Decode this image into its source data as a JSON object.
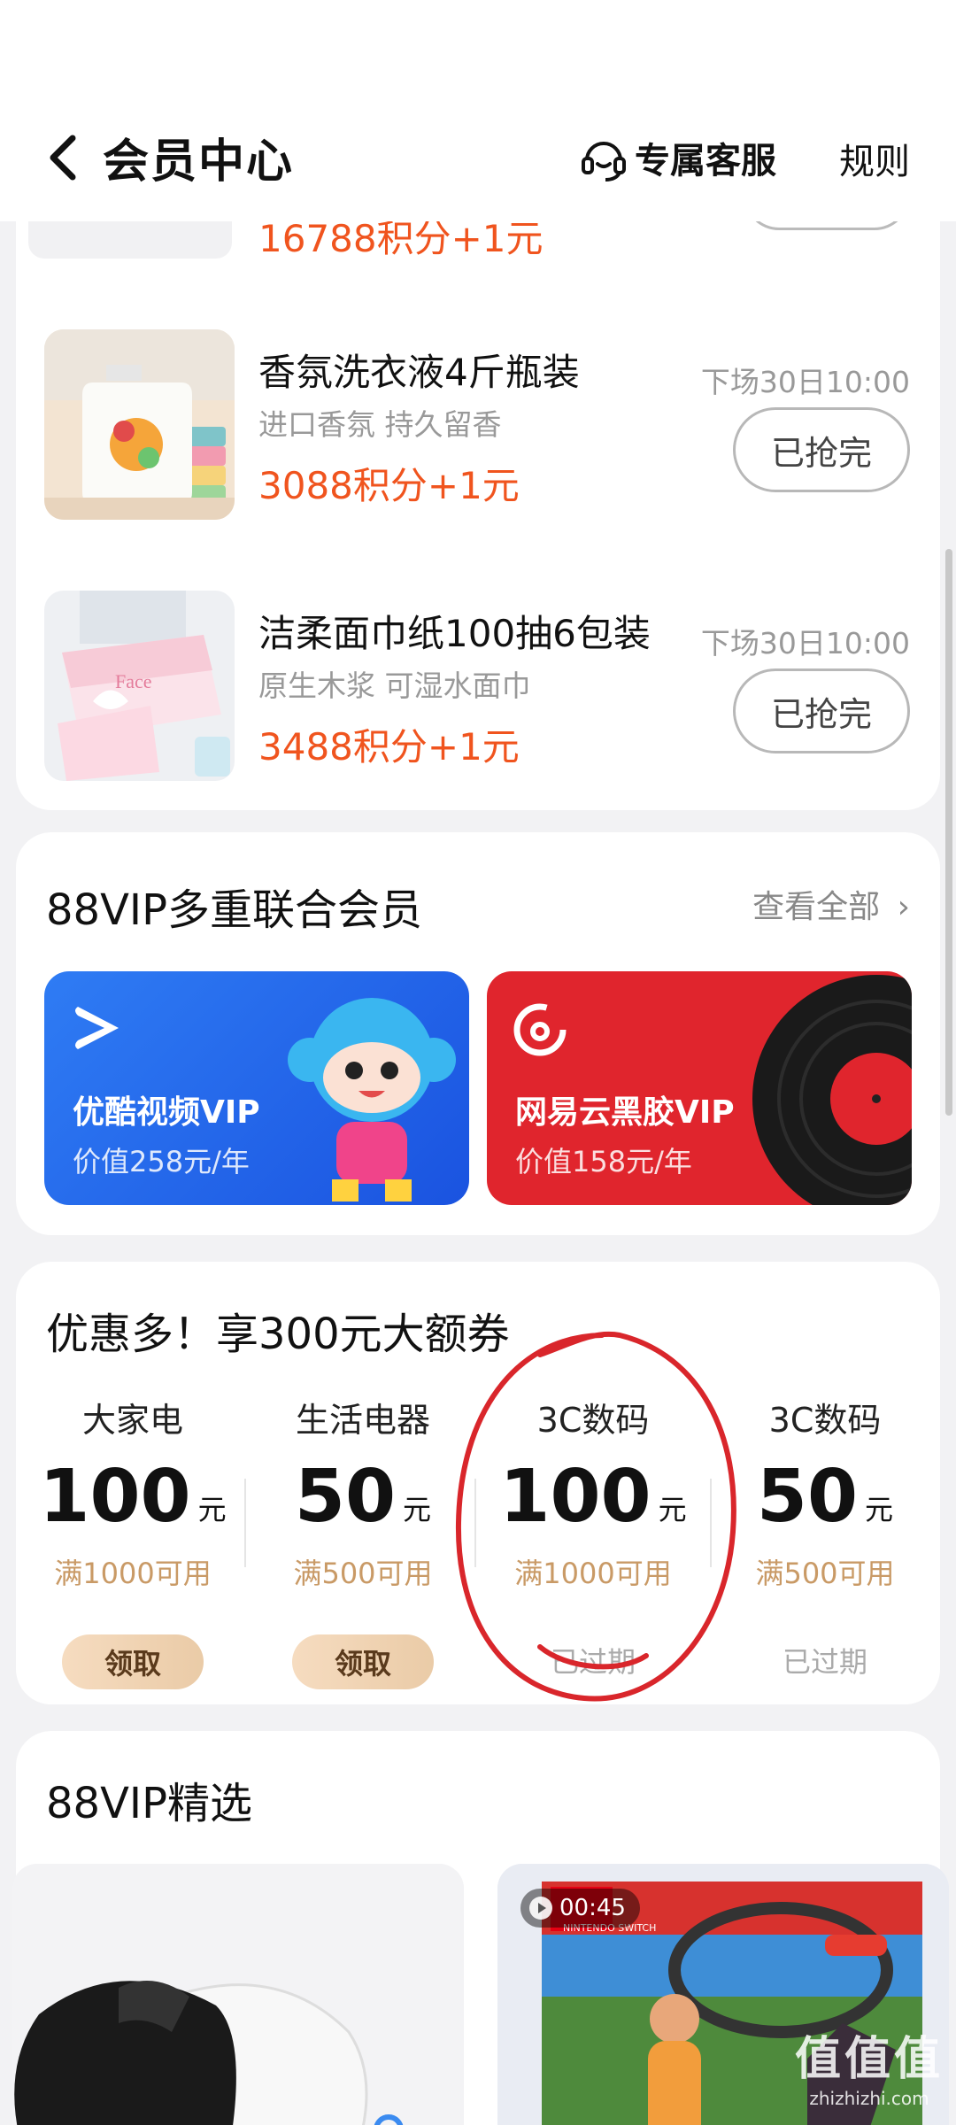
{
  "header": {
    "title": "会员中心",
    "customer_service": "专属客服",
    "rules": "规则"
  },
  "partial_product": {
    "price": "16788积分+1元"
  },
  "products": [
    {
      "name": "香氛洗衣液4斤瓶装",
      "subtitle": "进口香氛 持久留香",
      "price": "3088积分+1元",
      "next_session": "下场30日10:00",
      "button": "已抢完"
    },
    {
      "name": "洁柔面巾纸100抽6包装",
      "subtitle": "原生木浆 可湿水面巾",
      "price": "3488积分+1元",
      "next_session": "下场30日10:00",
      "button": "已抢完"
    }
  ],
  "vip_section": {
    "title": "88VIP多重联合会员",
    "view_all": "查看全部",
    "tiles": [
      {
        "name": "优酷视频VIP",
        "value": "价值258元/年",
        "color": "#2f7cf4"
      },
      {
        "name": "网易云黑胶VIP",
        "value": "价值158元/年",
        "color": "#e0252d"
      }
    ]
  },
  "coupon_section": {
    "title": "优惠多！享300元大额券",
    "coupons": [
      {
        "category": "大家电",
        "amount": "100",
        "unit": "元",
        "condition": "满1000可用",
        "action": "领取"
      },
      {
        "category": "生活电器",
        "amount": "50",
        "unit": "元",
        "condition": "满500可用",
        "action": "领取"
      },
      {
        "category": "3C数码",
        "amount": "100",
        "unit": "元",
        "condition": "满1000可用",
        "status": "已过期"
      },
      {
        "category": "3C数码",
        "amount": "50",
        "unit": "元",
        "condition": "满500可用",
        "status": "已过期"
      }
    ]
  },
  "selection_section": {
    "title": "88VIP精选",
    "video_duration": "00:45",
    "box_brand": "NINTENDO SWITCH"
  },
  "watermark": {
    "main": "值值值",
    "sub": "zhizhizhi.com"
  },
  "colors": {
    "price_orange": "#f0541e",
    "coupon_gold": "#c99a66",
    "annotation_red": "#d9262b"
  }
}
